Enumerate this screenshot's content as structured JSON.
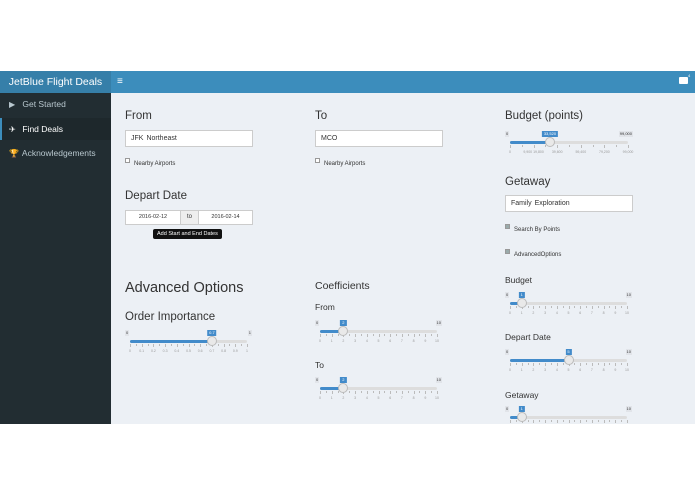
{
  "header": {
    "brand": "JetBlue Flight Deals",
    "toggle_glyph": "≡",
    "mail_icon": "envelope-icon",
    "mail_count": "4"
  },
  "sidebar": {
    "items": [
      {
        "label": "Get Started",
        "icon": "play-icon",
        "glyph": "▶",
        "active": false
      },
      {
        "label": "Find Deals",
        "icon": "plane-icon",
        "glyph": "✈",
        "active": true
      },
      {
        "label": "Acknowledgements",
        "icon": "trophy-icon",
        "glyph": "🏆",
        "active": false
      }
    ]
  },
  "from": {
    "label": "From",
    "tokens": [
      "JFK",
      "Northeast"
    ],
    "nearby_label": "Nearby Airports",
    "nearby_checked": false
  },
  "to": {
    "label": "To",
    "tokens": [
      "MCO"
    ],
    "nearby_label": "Nearby Airports",
    "nearby_checked": false
  },
  "depart": {
    "label": "Depart Date",
    "start": "2016-02-12",
    "sep": "to",
    "end": "2016-02-14",
    "tooltip": "Add Start and End Dates"
  },
  "budget": {
    "label": "Budget (points)",
    "slider": {
      "min": 0,
      "max": 99000,
      "value": 33520,
      "min_label": "0",
      "max_label": "99,000",
      "value_label": "33,520",
      "ticks": [
        "0",
        "9,900 19,800",
        "39,600",
        "59,400",
        "79,200",
        "99,000"
      ]
    }
  },
  "getaway": {
    "label": "Getaway",
    "tokens": [
      "Family",
      "Exploration"
    ],
    "search_by_points_label": "Search By Points",
    "search_by_points_checked": true,
    "advanced_label": "AdvancedOptions",
    "advanced_checked": true
  },
  "advanced": {
    "title": "Advanced Options"
  },
  "order_importance": {
    "label": "Order Importance",
    "slider": {
      "min": 0,
      "max": 1,
      "value": 0.7,
      "min_label": "0",
      "max_label": "1",
      "value_label": "0.7",
      "ticks": [
        "0",
        "0.1",
        "0.2",
        "0.3",
        "0.4",
        "0.5",
        "0.6",
        "0.7",
        "0.8",
        "0.9",
        "1"
      ]
    }
  },
  "coefficients": {
    "title": "Coefficients",
    "from": {
      "label": "From",
      "slider": {
        "min": 0,
        "max": 10,
        "value": 2,
        "min_label": "0",
        "max_label": "10",
        "value_label": "2",
        "ticks": [
          "0",
          "1",
          "2",
          "3",
          "4",
          "5",
          "6",
          "7",
          "8",
          "9",
          "10"
        ]
      }
    },
    "to": {
      "label": "To",
      "slider": {
        "min": 0,
        "max": 10,
        "value": 2,
        "min_label": "0",
        "max_label": "10",
        "value_label": "2",
        "ticks": [
          "0",
          "1",
          "2",
          "3",
          "4",
          "5",
          "6",
          "7",
          "8",
          "9",
          "10"
        ]
      }
    }
  },
  "weights": {
    "budget": {
      "label": "Budget",
      "slider": {
        "min": 0,
        "max": 10,
        "value": 1,
        "min_label": "0",
        "max_label": "10",
        "value_label": "1",
        "ticks": [
          "0",
          "1",
          "2",
          "3",
          "4",
          "5",
          "6",
          "7",
          "8",
          "9",
          "10"
        ]
      }
    },
    "depart": {
      "label": "Depart Date",
      "slider": {
        "min": 0,
        "max": 10,
        "value": 5,
        "min_label": "0",
        "max_label": "10",
        "value_label": "5",
        "ticks": [
          "0",
          "1",
          "2",
          "3",
          "4",
          "5",
          "6",
          "7",
          "8",
          "9",
          "10"
        ]
      }
    },
    "getaway": {
      "label": "Getaway",
      "slider": {
        "min": 0,
        "max": 10,
        "value": 1,
        "min_label": "0",
        "max_label": "10",
        "value_label": "1",
        "ticks": [
          "0",
          "1",
          "2",
          "3",
          "4",
          "5",
          "6",
          "7",
          "8",
          "9",
          "10"
        ]
      }
    }
  },
  "colors": {
    "header": "#3c8dbc",
    "brand_bg": "#367fa9",
    "sidebar": "#222d32",
    "content": "#ecf0f5",
    "slider": "#428bca"
  }
}
